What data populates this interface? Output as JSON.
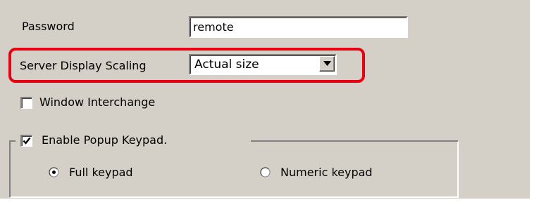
{
  "password": {
    "label": "Password",
    "value": "remote"
  },
  "server_display_scaling": {
    "label": "Server Display Scaling",
    "selected": "Actual size",
    "highlight_color": "#e60012"
  },
  "window_interchange": {
    "label": "Window Interchange",
    "checked": false
  },
  "popup_keypad": {
    "label": "Enable Popup Keypad.",
    "checked": true,
    "options": [
      {
        "label": "Full keypad",
        "selected": true
      },
      {
        "label": "Numeric keypad",
        "selected": false
      }
    ]
  },
  "colors": {
    "panel": "#d4d0c8",
    "highlight": "#e60012"
  }
}
